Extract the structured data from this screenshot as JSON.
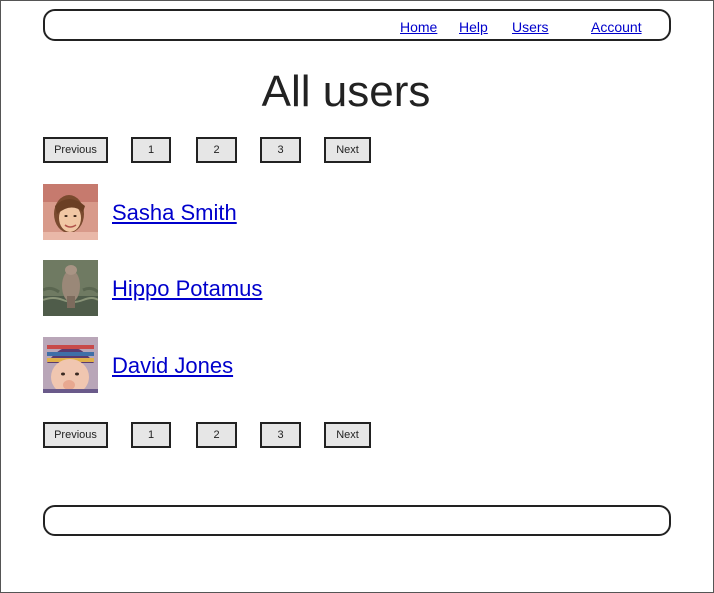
{
  "nav": {
    "home": "Home",
    "help": "Help",
    "users": "Users",
    "account": "Account"
  },
  "page_title": "All users",
  "pagination": {
    "previous": "Previous",
    "pages": [
      "1",
      "2",
      "3"
    ],
    "next": "Next"
  },
  "users": [
    {
      "name": "Sasha Smith",
      "avatar": "woman-portrait-photo"
    },
    {
      "name": "Hippo Potamus",
      "avatar": "hippo-photo"
    },
    {
      "name": "David Jones",
      "avatar": "baby-in-knit-hat-photo"
    }
  ],
  "colors": {
    "link": "#0000cc",
    "button_bg": "#e6e6e6",
    "border": "#222222"
  }
}
